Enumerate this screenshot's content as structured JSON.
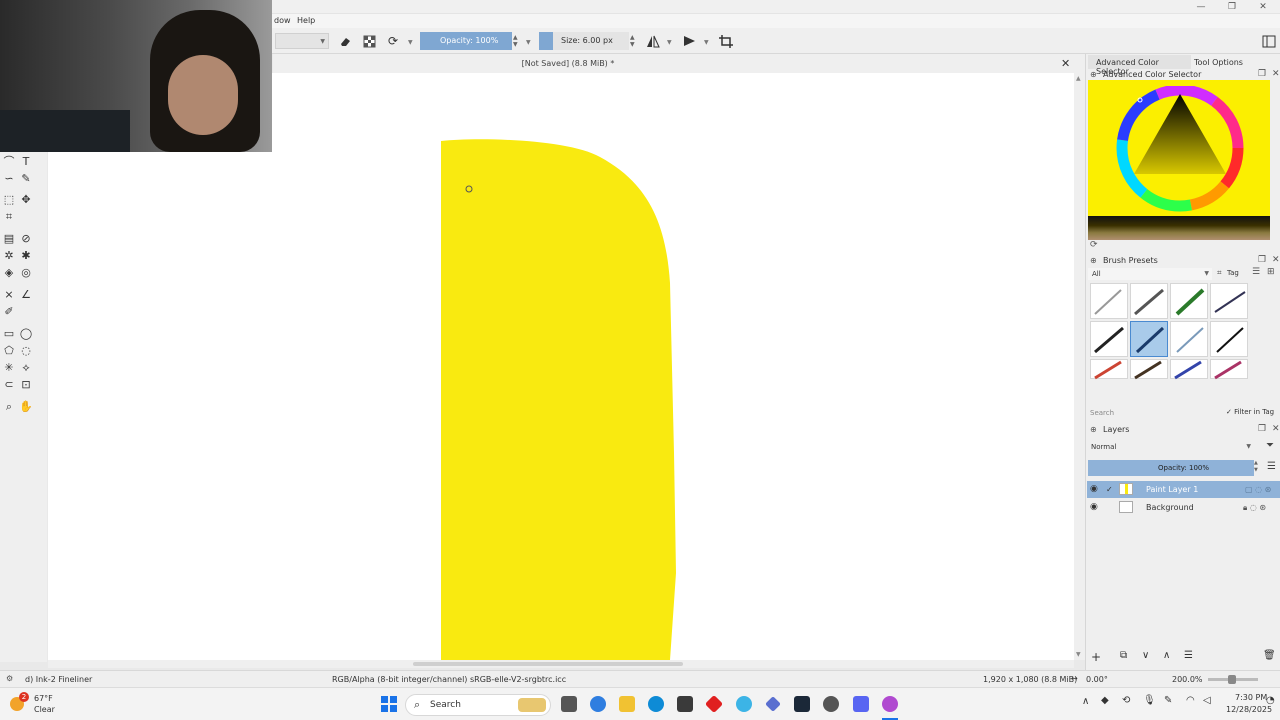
{
  "window": {
    "minimize_glyph": "—",
    "maximize_glyph": "❐",
    "close_glyph": "✕"
  },
  "menu": {
    "items": [
      "dow",
      "Help"
    ]
  },
  "toolbar": {
    "opacity_label": "Opacity: 100%",
    "size_label": "Size: 6.00 px"
  },
  "document": {
    "title": "[Not Saved]  (8.8 MiB) *",
    "close_glyph": "✕"
  },
  "canvas": {
    "shape_color": "#f9ea10",
    "background_color": "#ffffff"
  },
  "dock": {
    "tabs": [
      "Advanced Color Selector",
      "Tool Options"
    ],
    "color_selector": {
      "header": "Advanced Color Selector",
      "current_color": "#fbef00"
    },
    "brush_presets": {
      "header": "Brush Presets",
      "filter": "All",
      "tag_label": "Tag",
      "search_placeholder": "Search",
      "filter_in_tag": "Filter in Tag"
    },
    "layers": {
      "header": "Layers",
      "blend_mode": "Normal",
      "opacity_label": "Opacity:  100%",
      "items": [
        {
          "name": "Paint Layer 1",
          "selected": true
        },
        {
          "name": "Background",
          "selected": false
        }
      ]
    }
  },
  "status": {
    "brush_name": "d) Ink-2 Fineliner",
    "color_space": "RGB/Alpha (8-bit integer/channel)  sRGB-elle-V2-srgbtrc.icc",
    "image_size": "1,920 x 1,080 (8.8 MiB)",
    "rotation": "0.00°",
    "zoom": "200.0%"
  },
  "taskbar": {
    "weather_temp": "67°F",
    "weather_text": "Clear",
    "notification_count": "2",
    "search_label": "Search",
    "time": "7:30 PM",
    "date": "12/28/2025"
  }
}
